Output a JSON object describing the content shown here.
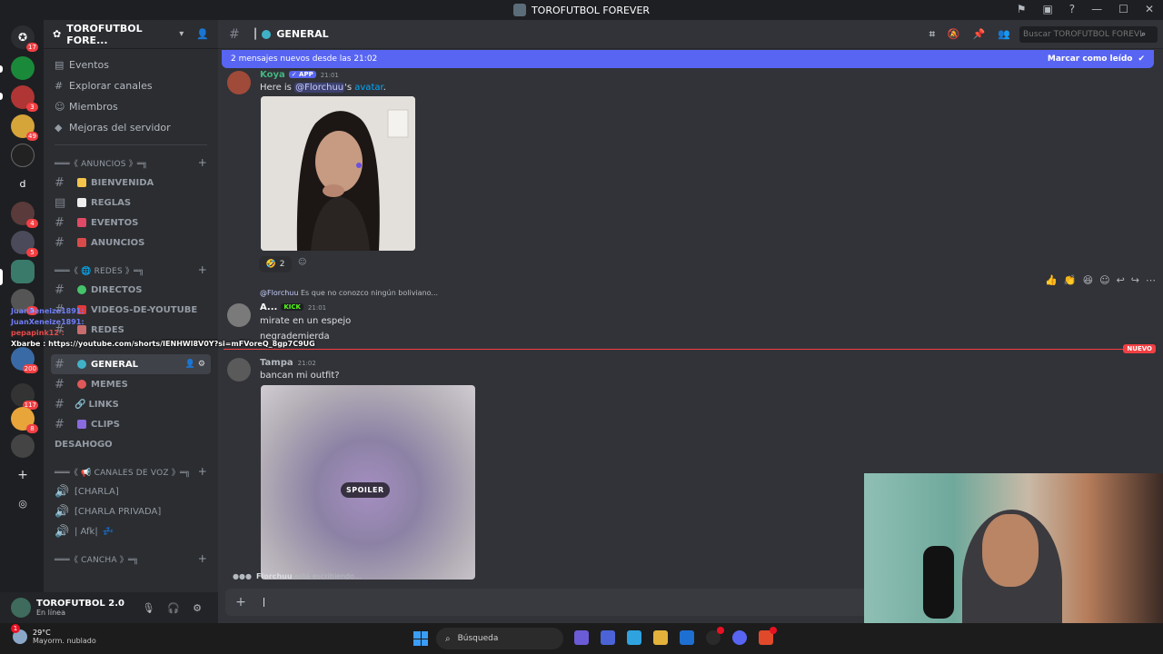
{
  "window": {
    "title": "TOROFUTBOL FOREVER"
  },
  "rail": {
    "badges": [
      "17",
      "3",
      "49",
      "4",
      "5",
      "8",
      "200",
      "117",
      "8"
    ],
    "dm_letter": "d"
  },
  "sidebar": {
    "server_name": "TOROFUTBOL FORE...",
    "menu": [
      "Eventos",
      "Explorar canales",
      "Miembros",
      "Mejoras del servidor"
    ],
    "categories": {
      "anuncios": "═══《 ANUNCIOS 》═╗",
      "redes": "═══《 🌐 REDES 》═╗",
      "voz": "═══《 📢 CANALES DE VOZ 》═╗",
      "cancha": "═══《 CANCHA 》═╗"
    },
    "channels": {
      "bienvenida": "BIENVENIDA",
      "reglas": "REGLAS",
      "eventos": "EVENTOS",
      "anuncios": "ANUNCIOS",
      "directos": "DIRECTOS",
      "videos": "VIDEOS-DE-YOUTUBE",
      "redes": "REDES",
      "general": "GENERAL",
      "memes": "MEMES",
      "links": "LINKS",
      "clips": "CLIPS",
      "desahogo": "DESAHOGO",
      "charla": "[CHARLA]",
      "charla_privada": "[CHARLA PRIVADA]",
      "afk": "| Afk|"
    }
  },
  "user": {
    "name": "TOROFUTBOL 2.0",
    "status": "En línea"
  },
  "channel_header": {
    "name": "GENERAL",
    "search_placeholder": "Buscar TOROFUTBOL FOREVER"
  },
  "banner": {
    "text": "2 mensajes nuevos desde las 21:02",
    "action": "Marcar como leído"
  },
  "messages": [
    {
      "author": "Koya",
      "tag": "✓ APP",
      "time": "21:01",
      "text_pre": "Here is ",
      "mention": "@Florchuu",
      "text_mid": "'s ",
      "link": "avatar",
      "text_post": ".",
      "reaction_count": "2"
    },
    {
      "reply_author": "@Florchuu",
      "reply_text": "Es que no conozco ningún boliviano...",
      "author": "A...",
      "tag": "KICK",
      "time": "21:01",
      "lines": [
        "mirate en un espejo",
        "negrademierda"
      ]
    },
    {
      "author": "Tampa",
      "time": "21:02",
      "text": "bancan mi outfit?",
      "spoiler": "SPOILER"
    }
  ],
  "new_marker": "NUEVO",
  "typing": {
    "user": "Florchuu",
    "text": "está escribiendo..."
  },
  "overlay": {
    "line1": "JuanXeneize1891: ",
    "line2": "JuanXeneize1891: ",
    "line3": "pepapink12 : ",
    "line4": "Xbarbe : https://youtube.com/shorts/IENHWl8V0Y?si=mFVoreQ_8gp7C9UG"
  },
  "taskbar": {
    "temp": "29°C",
    "weather": "Mayorm. nublado",
    "weather_badge": "1",
    "search_placeholder": "Búsqueda"
  }
}
